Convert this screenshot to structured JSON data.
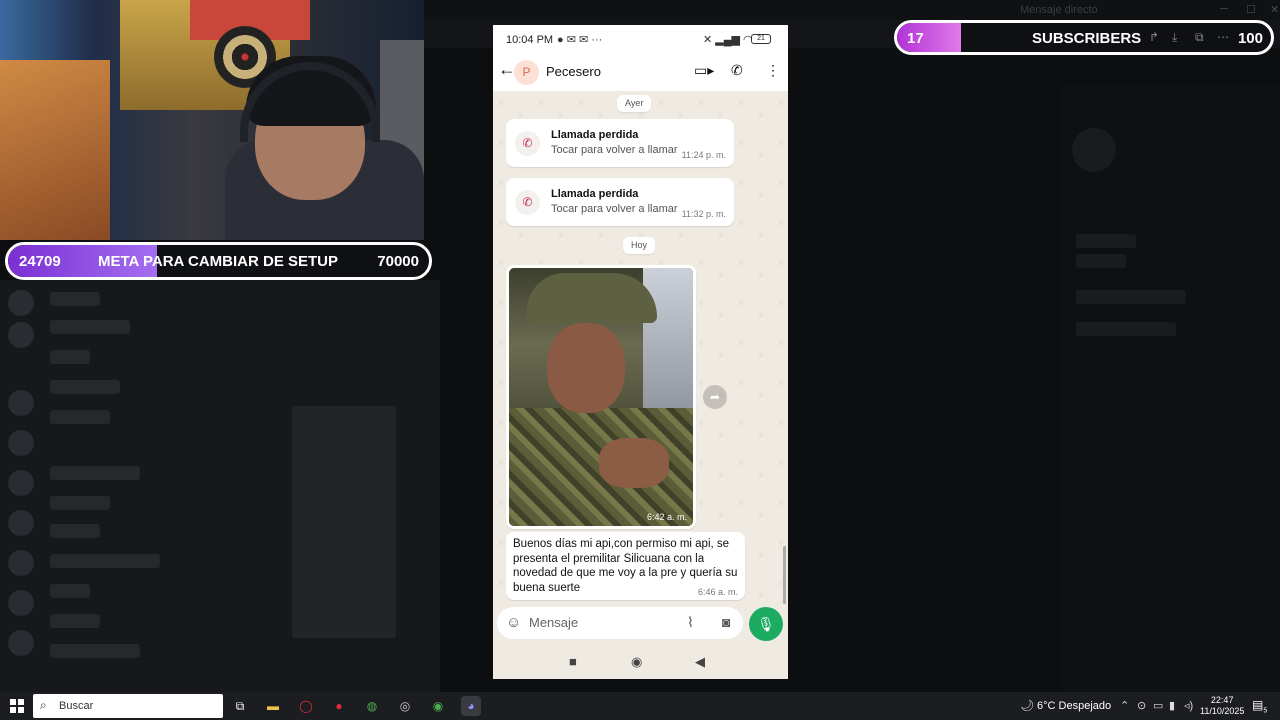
{
  "background": {
    "window_title": "Mensaje directo"
  },
  "stream_overlay": {
    "goal": {
      "current": "24709",
      "label": "META PARA CAMBIAR DE SETUP",
      "target": "70000",
      "progress": 0.353,
      "color": "#7b2fd3"
    },
    "subscribers": {
      "current": "17",
      "label": "SUBSCRIBERS",
      "target": "100",
      "progress": 0.17,
      "color": "#b233d8"
    }
  },
  "phone": {
    "status": {
      "time": "10:04 PM",
      "battery": "21"
    },
    "chat_header": {
      "avatar_initial": "P",
      "contact_name": "Pecesero"
    },
    "date_chips": [
      "Ayer",
      "Hoy"
    ],
    "missed_calls": [
      {
        "title": "Llamada perdida",
        "subtitle": "Tocar para volver a llamar",
        "time": "11:24 p. m."
      },
      {
        "title": "Llamada perdida",
        "subtitle": "Tocar para volver a llamar",
        "time": "11:32 p. m."
      }
    ],
    "photo_message": {
      "time": "6:42 a. m."
    },
    "text_message": {
      "text": "Buenos días mi api,con permiso mi api, se presenta el premilitar Silicuana con la novedad de que me voy a la pre y quería su buena suerte",
      "time": "6:46 a. m."
    },
    "composer": {
      "placeholder": "Mensaje"
    },
    "colors": {
      "chat_bg": "#efeae2",
      "mic_green": "#1daa61",
      "missed_call_icon": "#c0245d"
    }
  },
  "taskbar": {
    "search_placeholder": "Buscar",
    "weather": "6°C  Despejado",
    "clock_time": "22:47",
    "clock_date": "11/10/2025",
    "notification_count": "5"
  }
}
